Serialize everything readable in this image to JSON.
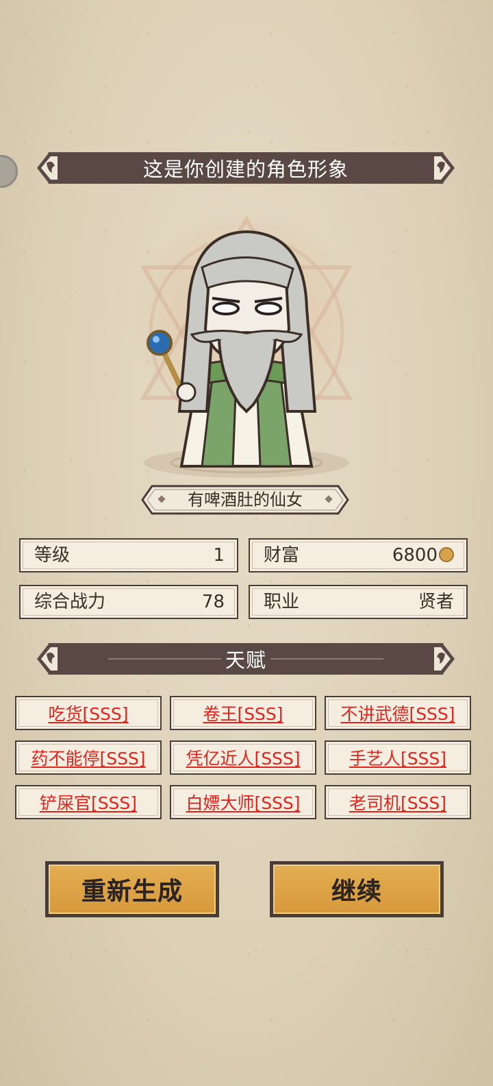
{
  "header": {
    "title": "这是你创建的角色形象"
  },
  "character": {
    "name": "有啤酒肚的仙女"
  },
  "stats": {
    "level_label": "等级",
    "level_value": "1",
    "wealth_label": "财富",
    "wealth_value": "6800",
    "power_label": "综合战力",
    "power_value": "78",
    "job_label": "职业",
    "job_value": "贤者"
  },
  "talents": {
    "title": "天赋",
    "items": [
      {
        "label": "吃货[SSS]"
      },
      {
        "label": "卷王[SSS]"
      },
      {
        "label": "不讲武德[SSS]"
      },
      {
        "label": "药不能停[SSS]"
      },
      {
        "label": "凭亿近人[SSS]"
      },
      {
        "label": "手艺人[SSS]"
      },
      {
        "label": "铲屎官[SSS]"
      },
      {
        "label": "白嫖大师[SSS]"
      },
      {
        "label": "老司机[SSS]"
      }
    ]
  },
  "buttons": {
    "regenerate": "重新生成",
    "continue": "继续"
  },
  "colors": {
    "banner": "#5a4845",
    "talent_text": "#e0241e",
    "button": "#dca045",
    "paper": "#e0d6bf"
  }
}
